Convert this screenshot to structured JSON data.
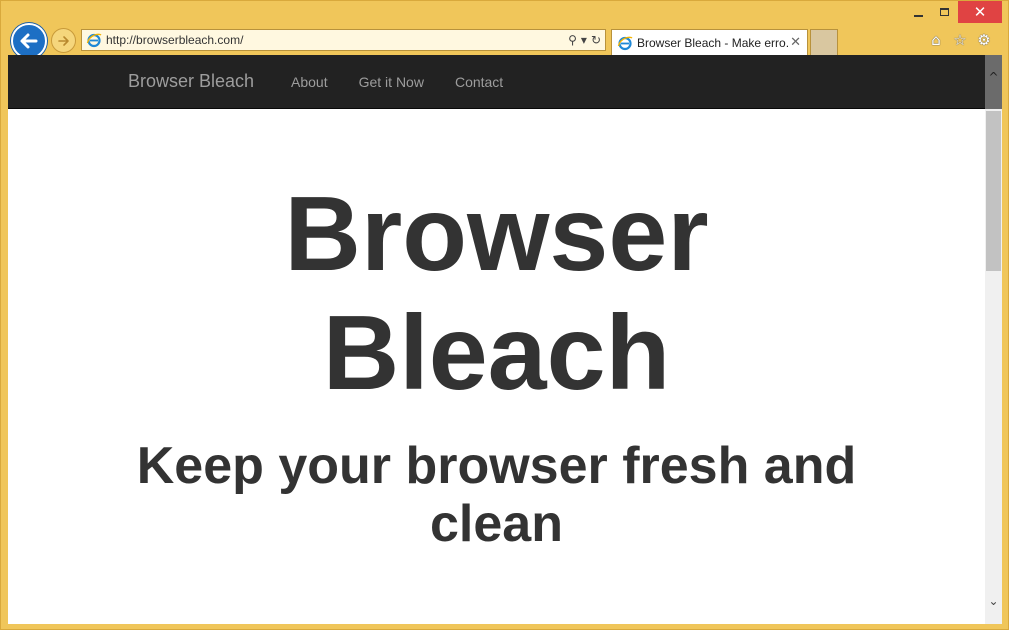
{
  "browser": {
    "address_url": "http://browserbleach.com/",
    "tab_title": "Browser Bleach - Make erro...",
    "tab_close": "✕",
    "addr_search_glyph": "⚲",
    "addr_dropdown_glyph": "▾",
    "addr_refresh_glyph": "↻",
    "window_close_glyph": "✕",
    "home_glyph": "⌂",
    "favorites_glyph": "☆",
    "settings_glyph": "⚙",
    "scroll_up_glyph": "^",
    "scroll_down_glyph": "⌄"
  },
  "site": {
    "brand": "Browser Bleach",
    "nav": [
      {
        "label": "About"
      },
      {
        "label": "Get it Now"
      },
      {
        "label": "Contact"
      }
    ],
    "hero": {
      "title_line1": "Browser",
      "title_line2": "Bleach",
      "subtitle_line1": "Keep your browser fresh and",
      "subtitle_line2": "clean"
    }
  },
  "colors": {
    "frame": "#f0c65a",
    "nav_bg": "#222222",
    "nav_text": "#9d9d9d",
    "back_button": "#1d6fc4",
    "close_button": "#e04343",
    "hero_text": "#333333"
  }
}
